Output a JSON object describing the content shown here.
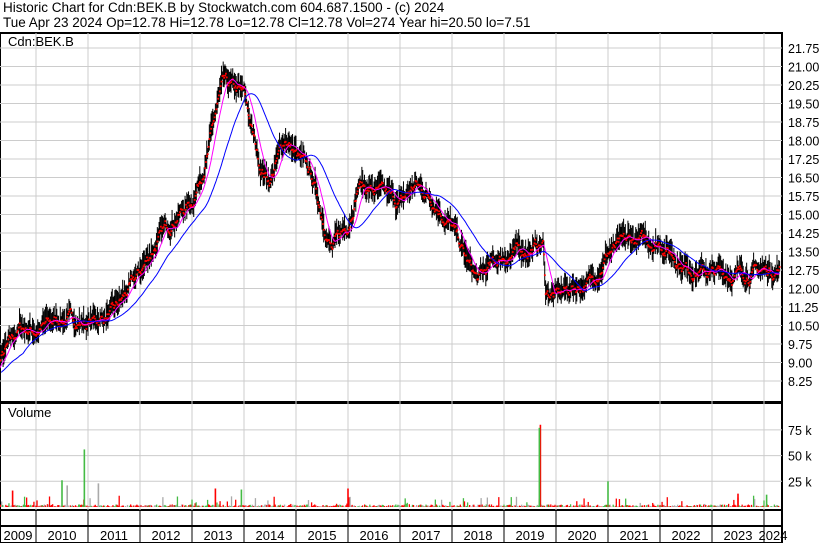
{
  "header": {
    "title": "Historic Chart for Cdn:BEK.B by Stockwatch.com 604.687.1500 - (c) 2024",
    "quote": "Tue Apr 23 2024  Op=12.78  Hi=12.78  Lo=12.78  Cl=12.78  Vol=274  Year hi=20.50  lo=7.51"
  },
  "chart_data": [
    {
      "type": "line",
      "title": "Cdn:BEK.B",
      "ylim": [
        7.5,
        22.2
      ],
      "yticks": [
        "21.75",
        "21.00",
        "20.25",
        "19.50",
        "18.75",
        "18.00",
        "17.25",
        "16.50",
        "15.75",
        "15.00",
        "14.25",
        "13.50",
        "12.75",
        "12.00",
        "11.25",
        "10.50",
        "9.75",
        "9.00",
        "8.25"
      ],
      "xticks": [
        "2009",
        "2010",
        "2011",
        "2012",
        "2013",
        "2014",
        "2015",
        "2016",
        "2017",
        "2018",
        "2019",
        "2020",
        "2021",
        "2022",
        "2023",
        "2024"
      ],
      "grid": true,
      "series_colors": {
        "bars": "#000000",
        "close": "#ff0000",
        "ma_short": "#ff00ff",
        "ma_long": "#0000ff"
      },
      "price_path": [
        [
          2009.0,
          8.0
        ],
        [
          2009.3,
          9.0
        ],
        [
          2009.7,
          10.4
        ],
        [
          2010.0,
          10.3
        ],
        [
          2010.5,
          10.8
        ],
        [
          2011.0,
          10.6
        ],
        [
          2011.5,
          11.0
        ],
        [
          2012.0,
          12.6
        ],
        [
          2012.3,
          13.8
        ],
        [
          2012.7,
          15.0
        ],
        [
          2013.0,
          15.5
        ],
        [
          2013.3,
          17.5
        ],
        [
          2013.5,
          19.5
        ],
        [
          2013.6,
          20.2
        ],
        [
          2014.0,
          19.8
        ],
        [
          2014.3,
          17.0
        ],
        [
          2014.5,
          16.4
        ],
        [
          2014.8,
          18.1
        ],
        [
          2015.0,
          17.4
        ],
        [
          2015.3,
          16.5
        ],
        [
          2015.5,
          15.0
        ],
        [
          2015.7,
          13.6
        ],
        [
          2016.0,
          14.6
        ],
        [
          2016.2,
          16.3
        ],
        [
          2016.8,
          15.6
        ],
        [
          2017.0,
          15.4
        ],
        [
          2017.3,
          16.2
        ],
        [
          2017.7,
          15.5
        ],
        [
          2018.0,
          14.5
        ],
        [
          2018.3,
          13.0
        ],
        [
          2018.5,
          12.3
        ],
        [
          2018.8,
          13.0
        ],
        [
          2019.0,
          13.3
        ],
        [
          2019.5,
          13.6
        ],
        [
          2019.75,
          13.8
        ],
        [
          2019.8,
          11.9
        ],
        [
          2020.0,
          11.7
        ],
        [
          2020.3,
          12.0
        ],
        [
          2020.7,
          12.3
        ],
        [
          2021.0,
          13.5
        ],
        [
          2021.5,
          13.9
        ],
        [
          2022.0,
          13.9
        ],
        [
          2022.5,
          12.9
        ],
        [
          2023.0,
          12.6
        ],
        [
          2023.5,
          12.6
        ],
        [
          2024.31,
          12.78
        ]
      ]
    },
    {
      "type": "bar",
      "title": "Volume",
      "ylim": [
        0,
        95000
      ],
      "yticks": [
        "75 k",
        "50 k",
        "25 k"
      ],
      "spikes": [
        [
          2009.55,
          16000,
          "#ff0000"
        ],
        [
          2010.5,
          26000,
          "#44bb44"
        ],
        [
          2010.6,
          21000,
          "#aaaaaa"
        ],
        [
          2010.93,
          56000,
          "#44bb44"
        ],
        [
          2011.2,
          23000,
          "#aaaaaa"
        ],
        [
          2013.45,
          18000,
          "#ff0000"
        ],
        [
          2013.95,
          17000,
          "#44bb44"
        ],
        [
          2016.0,
          18000,
          "#ff0000"
        ],
        [
          2019.7,
          80000,
          "#ff0000"
        ],
        [
          2019.68,
          77000,
          "#44bb44"
        ],
        [
          2021.0,
          25000,
          "#44bb44"
        ],
        [
          2023.5,
          13000,
          "#ff0000"
        ],
        [
          2024.05,
          12000,
          "#44bb44"
        ]
      ]
    }
  ]
}
